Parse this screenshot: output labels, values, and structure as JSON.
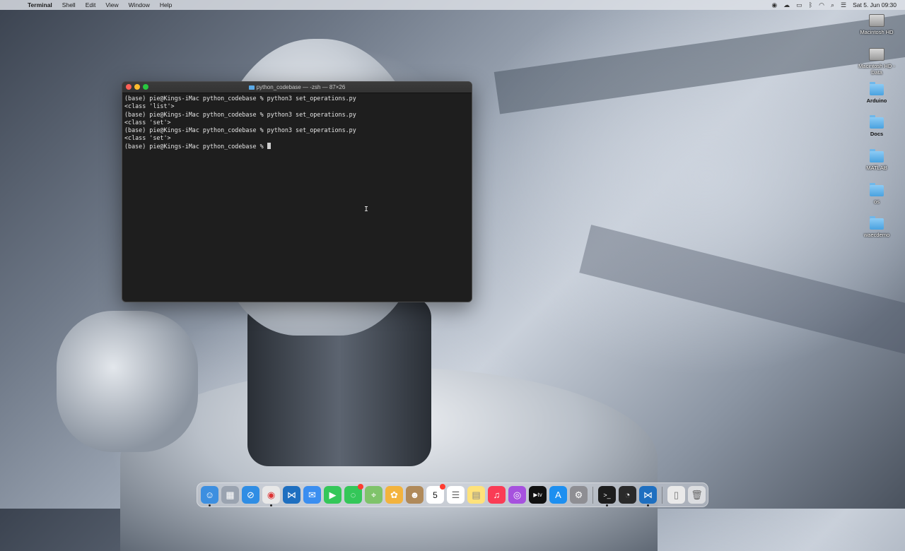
{
  "menubar": {
    "app": "Terminal",
    "items": [
      "Shell",
      "Edit",
      "View",
      "Window",
      "Help"
    ],
    "clock": "Sat 5. Jun  09:30"
  },
  "terminal": {
    "title": "python_codebase — -zsh — 87×26",
    "lines": [
      "(base) pie@Kings-iMac python_codebase % python3 set_operations.py",
      "<class 'list'>",
      "(base) pie@Kings-iMac python_codebase % python3 set_operations.py",
      "<class 'set'>",
      "(base) pie@Kings-iMac python_codebase % python3 set_operations.py",
      "<class 'set'>"
    ],
    "prompt": "(base) pie@Kings-iMac python_codebase % "
  },
  "desktop": {
    "icons": [
      {
        "label": "Macintosh HD",
        "kind": "disk-icon"
      },
      {
        "label": "Macintosh HD - Data",
        "kind": "disk-icon"
      },
      {
        "label": "Arduino",
        "kind": "folder-icon"
      },
      {
        "label": "Docs",
        "kind": "folder-icon"
      },
      {
        "label": "MATLAB",
        "kind": "folder-icon"
      },
      {
        "label": "os",
        "kind": "folder-icon"
      },
      {
        "label": "waecdemo",
        "kind": "folder-icon"
      }
    ]
  },
  "dock": {
    "calendar_day": "5",
    "apps": [
      "finder",
      "launchpad",
      "safari",
      "chrome",
      "vscode",
      "mail",
      "facetime",
      "messages",
      "maps",
      "photos",
      "contacts",
      "calendar",
      "reminders",
      "notes",
      "music",
      "podcasts",
      "tv",
      "app-store",
      "system-preferences",
      "terminal",
      "activity-monitor",
      "vscode-2"
    ],
    "colors": {
      "finder": "#3d8fe0",
      "launchpad": "#9aa3b0",
      "safari": "#2f8de4",
      "chrome": "#e8e8e8",
      "vscode": "#1e6fc0",
      "mail": "#3a8ef0",
      "facetime": "#34c759",
      "messages": "#34c759",
      "maps": "#7fc36a",
      "photos": "#f3b33d",
      "contacts": "#b08a5a",
      "calendar": "#ffffff",
      "reminders": "#ffffff",
      "notes": "#ffe27a",
      "music": "#fa3c55",
      "podcasts": "#a651de",
      "tv": "#111111",
      "app-store": "#1d8ff0",
      "system-preferences": "#8e8e93",
      "terminal": "#1d1d1d",
      "activity-monitor": "#2a2a2a"
    }
  }
}
